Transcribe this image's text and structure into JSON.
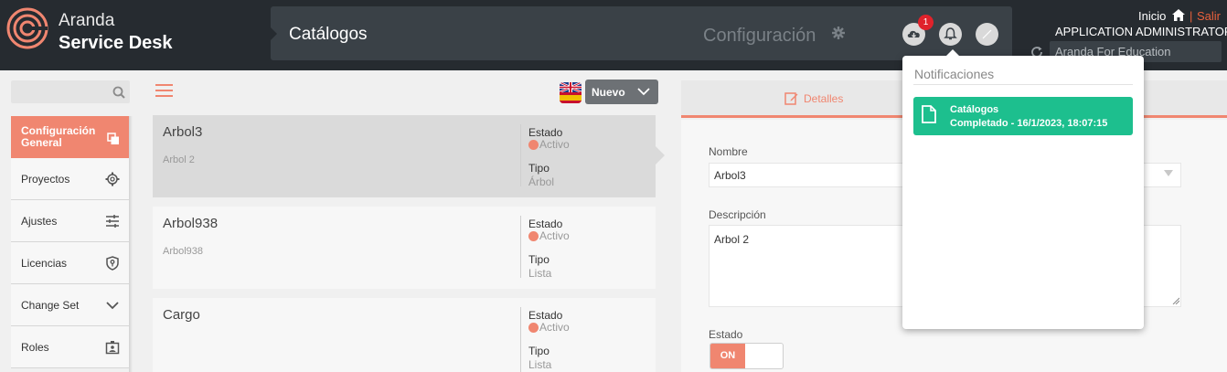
{
  "header": {
    "brand_line1": "Aranda",
    "brand_line2": "Service Desk",
    "module_title": "Catálogos",
    "config_label": "Configuración",
    "badge_count": "1",
    "inicio": "Inicio",
    "separator": "|",
    "salir": "Salir",
    "user_name": "APPLICATION ADMINISTRATOR",
    "project": "Aranda For Education"
  },
  "sidebar": {
    "items": [
      {
        "label": "Configuración General",
        "icon": "copy-icon",
        "active": true
      },
      {
        "label": "Proyectos",
        "icon": "gear-icon",
        "active": false
      },
      {
        "label": "Ajustes",
        "icon": "sliders-icon",
        "active": false
      },
      {
        "label": "Licencias",
        "icon": "shield-key-icon",
        "active": false
      },
      {
        "label": "Change Set",
        "icon": "chevron-down-icon",
        "active": false
      },
      {
        "label": "Roles",
        "icon": "badge-icon",
        "active": false
      }
    ]
  },
  "list": {
    "new_button": "Nuevo",
    "cards": [
      {
        "name": "Arbol3",
        "description": "Arbol 2",
        "estado_label": "Estado",
        "estado": "Activo",
        "tipo_label": "Tipo",
        "tipo": "Árbol",
        "selected": true
      },
      {
        "name": "Arbol938",
        "description": "Arbol938",
        "estado_label": "Estado",
        "estado": "Activo",
        "tipo_label": "Tipo",
        "tipo": "Lista",
        "selected": false
      },
      {
        "name": "Cargo",
        "description": "",
        "estado_label": "Estado",
        "estado": "Activo",
        "tipo_label": "Tipo",
        "tipo": "Lista",
        "selected": false
      }
    ]
  },
  "detail": {
    "tab_label": "Detalles",
    "nombre_label": "Nombre",
    "nombre_value": "Arbol3",
    "descripcion_label": "Descripción",
    "descripcion_value": "Arbol 2",
    "estado_label": "Estado",
    "toggle_on": "ON"
  },
  "notifications": {
    "title": "Notificaciones",
    "items": [
      {
        "title": "Catálogos",
        "detail": "Completado - 16/1/2023, 18:07:15"
      }
    ]
  },
  "colors": {
    "accent": "#f08670",
    "header_bg": "#262b30",
    "notification_success": "#1dbf8e"
  }
}
